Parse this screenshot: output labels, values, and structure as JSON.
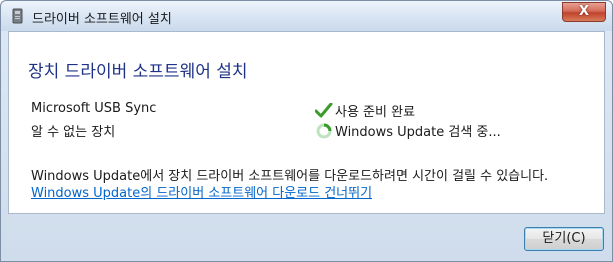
{
  "window": {
    "title": "드라이버 소프트웨어 설치",
    "close_glyph": "X"
  },
  "main": {
    "heading": "장치 드라이버 소프트웨어 설치",
    "devices": [
      {
        "name": "Microsoft USB Sync",
        "status": "사용 준비 완료",
        "status_icon": "checkmark-icon"
      },
      {
        "name": "알 수 없는 장치",
        "status": "Windows Update 검색 중...",
        "status_icon": "spinner-icon"
      }
    ],
    "info_text": "Windows Update에서 장치 드라이버 소프트웨어를 다운로드하려면 시간이 걸릴 수 있습니다.",
    "skip_link": "Windows Update의 드라이버 소프트웨어 다운로드 건너뛰기"
  },
  "footer": {
    "close_label": "닫기(C)"
  },
  "colors": {
    "heading": "#1e3287",
    "link": "#0066cc",
    "check": "#3a9a2a"
  }
}
